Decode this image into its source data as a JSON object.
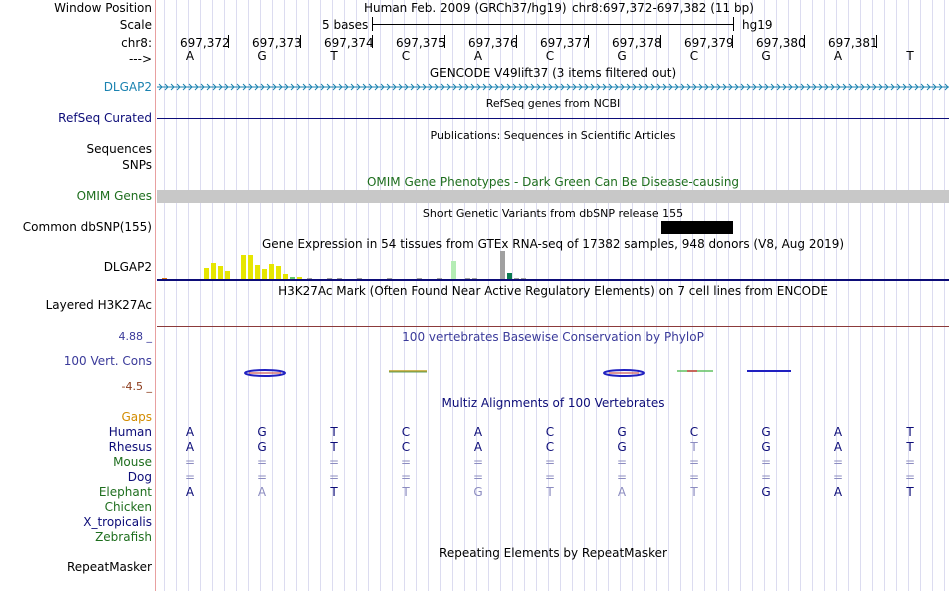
{
  "colors": {
    "navy": "#0c0c78",
    "teal": "#1a82b0",
    "omim_green": "#1e6e1e",
    "phylop_blue": "#3a3a9a",
    "phylop_neg": "#8b3a1a",
    "gaps_orange": "#d28c00",
    "gray_bar": "#c8c8c8",
    "species_green": "#1e6e1e",
    "species_navy": "#0c0c78",
    "faded": "#8c8cc0",
    "gtex_yellow": "#e6e600",
    "gtex_green": "#66cc66",
    "gtex_lightgreen": "#b4ecb4",
    "gtex_gray": "#a0a0a0",
    "gtex_teal": "#0a7a50",
    "gtex_orange": "#e07a10"
  },
  "labels": {
    "window_position": "Window Position",
    "scale": "Scale",
    "chr": "chr8:",
    "arrow": "--->",
    "dlgap2_gencode": "DLGAP2",
    "refseq": "RefSeq Curated",
    "sequences": "Sequences",
    "snps": "SNPs",
    "omim": "OMIM Genes",
    "dbsnp": "Common dbSNP(155)",
    "dlgap2_gtex": "DLGAP2",
    "h3k27ac": "Layered H3K27Ac",
    "phylop_max": "4.88 _",
    "vert_cons": "100 Vert. Cons",
    "phylop_min": "-4.5 _",
    "gaps": "Gaps",
    "repeatmasker": "RepeatMasker"
  },
  "header": {
    "assembly": "Human Feb. 2009 (GRCh37/hg19)",
    "position": "chr8:697,372-697,382 (11 bp)",
    "scale_text": "5 bases",
    "scale_db": "hg19"
  },
  "coords": [
    "697,372",
    "697,373",
    "697,374",
    "697,375",
    "697,376",
    "697,377",
    "697,378",
    "697,379",
    "697,380",
    "697,381"
  ],
  "bases": [
    "A",
    "G",
    "T",
    "C",
    "A",
    "C",
    "G",
    "C",
    "G",
    "A",
    "T"
  ],
  "tracks": {
    "gencode_title": "GENCODE V49lift37 (3 items filtered out)",
    "refseq_title": "RefSeq genes from NCBI",
    "publications_title": "Publications: Sequences in Scientific Articles",
    "omim_title": "OMIM Gene Phenotypes - Dark Green Can Be Disease-causing",
    "dbsnp_title": "Short Genetic Variants from dbSNP release 155",
    "gtex_title": "Gene Expression in 54 tissues from GTEx RNA-seq of 17382 samples, 948 donors (V8, Aug 2019)",
    "h3k27ac_title": "H3K27Ac Mark (Often Found Near Active Regulatory Elements) on 7 cell lines from ENCODE",
    "phylop_title": "100 vertebrates Basewise Conservation by PhyloP",
    "multiz_title": "Multiz Alignments of 100 Vertebrates",
    "repeat_title": "Repeating Elements by RepeatMasker"
  },
  "species": [
    {
      "name": "Human",
      "color": "navy",
      "bases": [
        "A",
        "G",
        "T",
        "C",
        "A",
        "C",
        "G",
        "C",
        "G",
        "A",
        "T"
      ],
      "faded": []
    },
    {
      "name": "Rhesus",
      "color": "navy",
      "bases": [
        "A",
        "G",
        "T",
        "C",
        "A",
        "C",
        "G",
        "T",
        "G",
        "A",
        "T"
      ],
      "faded": [
        7
      ]
    },
    {
      "name": "Mouse",
      "color": "green",
      "bases": [
        "=",
        "=",
        "=",
        "=",
        "=",
        "=",
        "=",
        "=",
        "=",
        "=",
        "="
      ],
      "faded": [
        0,
        1,
        2,
        3,
        4,
        5,
        6,
        7,
        8,
        9,
        10
      ]
    },
    {
      "name": "Dog",
      "color": "navy",
      "bases": [
        "=",
        "=",
        "=",
        "=",
        "=",
        "=",
        "=",
        "=",
        "=",
        "=",
        "="
      ],
      "faded": [
        0,
        1,
        2,
        3,
        4,
        5,
        6,
        7,
        8,
        9,
        10
      ]
    },
    {
      "name": "Elephant",
      "color": "green",
      "bases": [
        "A",
        "A",
        "T",
        "T",
        "G",
        "T",
        "A",
        "T",
        "G",
        "A",
        "T"
      ],
      "faded": [
        1,
        3,
        4,
        5,
        6,
        7
      ]
    },
    {
      "name": "Chicken",
      "color": "green",
      "bases": [],
      "faded": []
    },
    {
      "name": "X_tropicalis",
      "color": "navy",
      "bases": [],
      "faded": []
    },
    {
      "name": "Zebrafish",
      "color": "green",
      "bases": [],
      "faded": []
    }
  ]
}
